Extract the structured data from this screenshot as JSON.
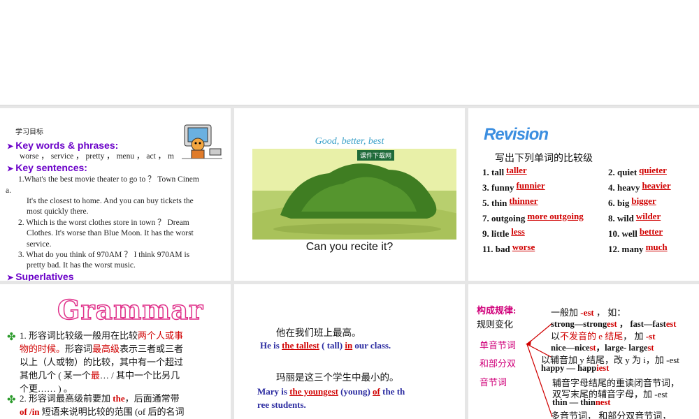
{
  "slide1": {
    "heading": "学习目标",
    "kw_label": "Key words & phrases:",
    "kw_text": "worse ，  service ，  pretty ，  menu ，  act ，  m",
    "ks_label": "Key sentences:",
    "s1a": "1.What's the best movie theater to go to ？  Town Cinem",
    "s1b": "a.",
    "s1c": "It's the closest to home. And you can buy tickets the",
    "s1d": "most quickly there.",
    "s2a": "2. Which is the worst clothes store in town ？  Dream",
    "s2b": "Clothes. It's worse than Blue Moon. It has the worst",
    "s2c": "service.",
    "s3a": "3. What do you think of 970AM ？  I think 970AM is",
    "s3b": "pretty bad. It has the worst music.",
    "sup_label": "Superlatives"
  },
  "slide2": {
    "title": "Good, better, best",
    "caption": "Can you recite it?",
    "badge": "课件下载网"
  },
  "slide3": {
    "title": "Revision",
    "instr": "写出下列单词的比较级",
    "items": [
      {
        "num": "1. tall",
        "ans": "taller"
      },
      {
        "num": "2. quiet",
        "ans": "quieter"
      },
      {
        "num": "3. funny",
        "ans": "funnier"
      },
      {
        "num": "4. heavy",
        "ans": "heavier"
      },
      {
        "num": "5. thin",
        "ans": "thinner"
      },
      {
        "num": "6. big",
        "ans": "bigger"
      },
      {
        "num": "7. outgoing",
        "ans": "more outgoing"
      },
      {
        "num": "8. wild",
        "ans": "wilder"
      },
      {
        "num": "9. little",
        "ans": "less"
      },
      {
        "num": "10. well",
        "ans": "better"
      },
      {
        "num": "11. bad",
        "ans": "worse"
      },
      {
        "num": "12. many",
        "ans": "much"
      }
    ]
  },
  "slide4": {
    "title": "Grammar",
    "p1a": "1. 形容词比较级一般用在比较",
    "p1b": "两个人或事",
    "p1c": "物的时候。",
    "p1d": "形容词",
    "p1e": "最高级",
    "p1f": "表示三者或三者",
    "p1g": "以上（人或物）的比较，其中有一个超过",
    "p1h": "其他几个 ( 某一个",
    "p1i": "最",
    "p1j": "… / 其中一个比另几",
    "p1k": "个更…… ) 。",
    "p2a": "2. 形容词最高级前要加 ",
    "p2b": "the",
    "p2c": "，后面通常带",
    "p2d": "of /in",
    "p2e": " 短语来说明比较的范围 (of  后的名词"
  },
  "slide5": {
    "cn1": "他在我们班上最高。",
    "e1a": "He is ",
    "e1b": "the tallest",
    "e1c": " ( tall) ",
    "e1d": "in",
    "e1e": " our class.",
    "cn2": "玛丽是这三个学生中最小的。",
    "e2a": "Mary is ",
    "e2b": "the youngest",
    "e2c": " (young) ",
    "e2d": "of",
    "e2e": " the th",
    "e2f": "ree students."
  },
  "slide6": {
    "title": "构成规律:",
    "sub": "规则变化",
    "cat1": "单音节词",
    "cat2": "和部分双",
    "cat3": "音节词",
    "r1a": "一般加 ",
    "r1b": " -est",
    "r1c": " ，  如：",
    "r2a": "strong—strong",
    "r2b": "est",
    "r2c": " ，  fast—fast",
    "r2d": "est",
    "r3a": "以",
    "r3b": "不发音的 e 结尾",
    "r3c": "，  加 ",
    "r3d": "-st",
    "r4a": "nice—nice",
    "r4b": "st",
    "r4c": "，large- large",
    "r4d": "st",
    "r5": "以辅音加 y 结尾，改 y 为 i，加 -est",
    "r6a": "happy — happ",
    "r6b": "iest",
    "r7": "辅音字母结尾的重读闭音节词，",
    "r8": "双写末尾的辅音字母，加 -est",
    "r9a": "thin — thin",
    "r9b": "nest",
    "r10": "多音节词，   和部分双音节词，"
  }
}
